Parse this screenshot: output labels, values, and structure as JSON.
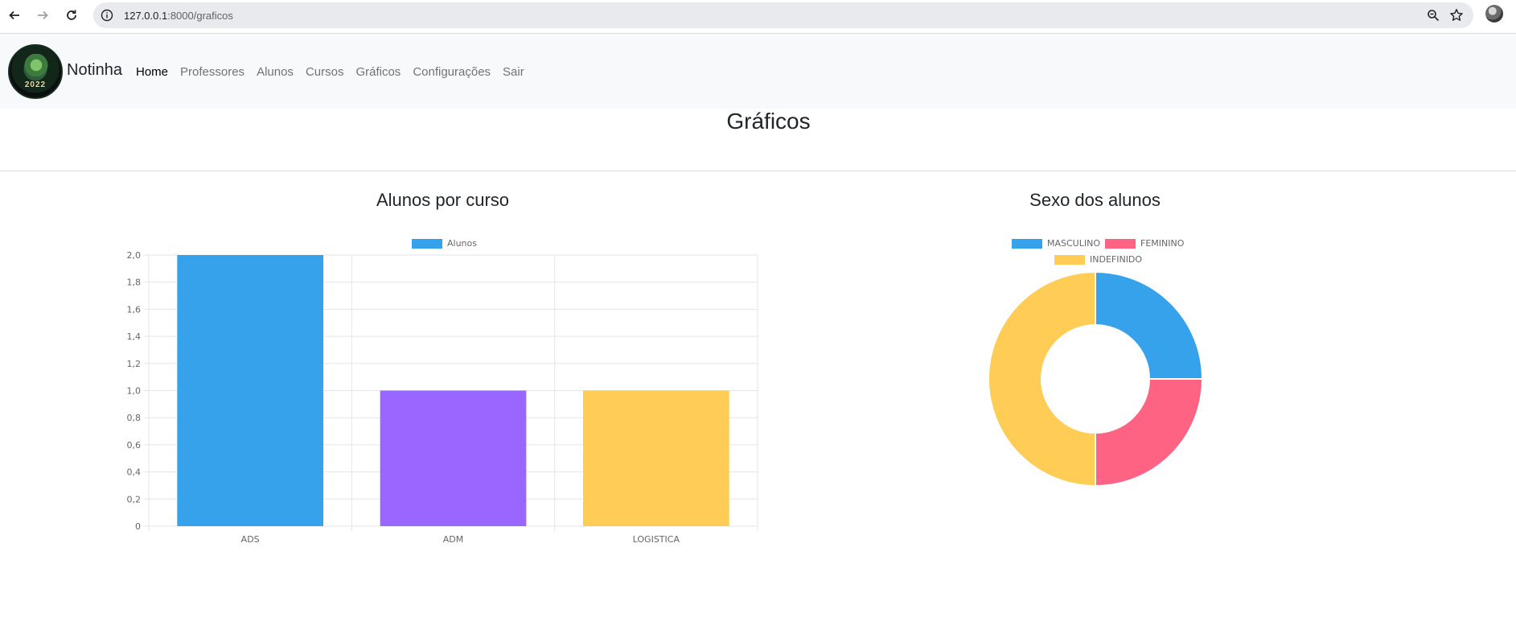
{
  "browser": {
    "url_host": "127.0.0.1",
    "url_path": ":8000/graficos"
  },
  "navbar": {
    "brand": "Notinha",
    "logo_year": "2022",
    "links": [
      {
        "label": "Home",
        "active": true
      },
      {
        "label": "Professores",
        "active": false
      },
      {
        "label": "Alunos",
        "active": false
      },
      {
        "label": "Cursos",
        "active": false
      },
      {
        "label": "Gráficos",
        "active": false
      },
      {
        "label": "Configurações",
        "active": false
      },
      {
        "label": "Sair",
        "active": false
      }
    ]
  },
  "page": {
    "title": "Gráficos"
  },
  "chart_data": [
    {
      "type": "bar",
      "title": "Alunos por curso",
      "categories": [
        "ADS",
        "ADM",
        "LOGISTICA"
      ],
      "series": [
        {
          "name": "Alunos",
          "values": [
            2,
            1,
            1
          ]
        }
      ],
      "bar_colors": [
        "#36a2eb",
        "#9966ff",
        "#ffcd56"
      ],
      "legend_color": "#36a2eb",
      "ylim": [
        0,
        2
      ],
      "y_ticks": [
        "0",
        "0,2",
        "0,4",
        "0,6",
        "0,8",
        "1,0",
        "1,2",
        "1,4",
        "1,6",
        "1,8",
        "2,0"
      ],
      "grid": true,
      "legend_position": "top"
    },
    {
      "type": "pie",
      "variant": "doughnut",
      "title": "Sexo dos alunos",
      "labels": [
        "MASCULINO",
        "FEMININO",
        "INDEFINIDO"
      ],
      "values": [
        1,
        1,
        2
      ],
      "colors": [
        "#36a2eb",
        "#ff6384",
        "#ffcd56"
      ],
      "legend_position": "top"
    }
  ]
}
